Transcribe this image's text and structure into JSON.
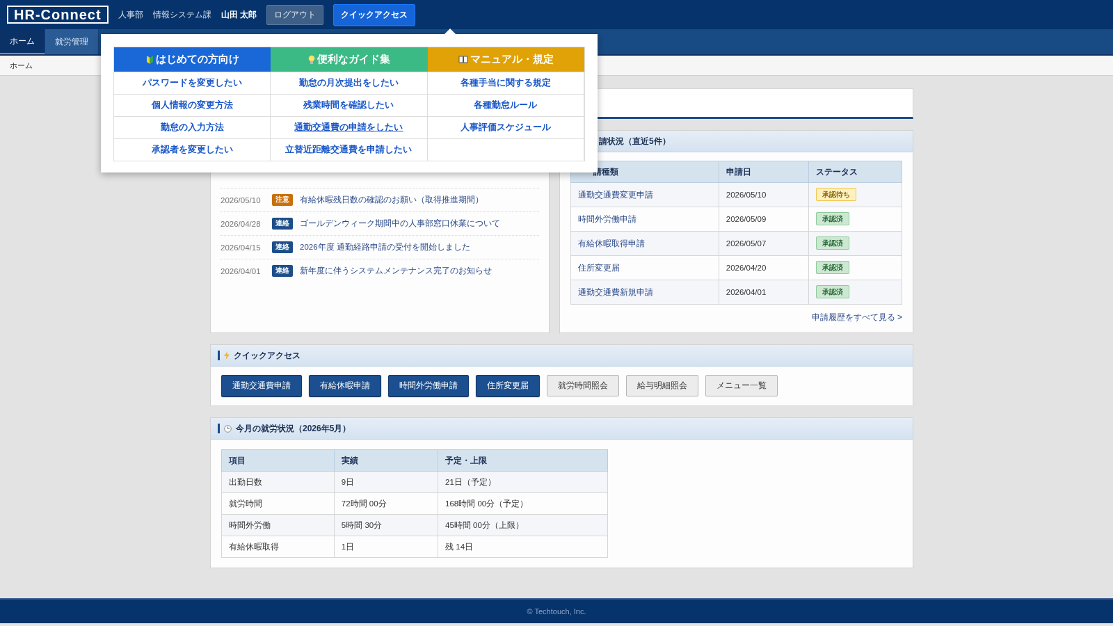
{
  "header": {
    "logo": "HR-Connect",
    "department": "人事部",
    "section": "情報システム課",
    "user": "山田 太郎",
    "buttons": [
      {
        "label": "ログアウト",
        "selected": false
      },
      {
        "label": "クイックアクセス",
        "selected": true
      }
    ]
  },
  "nav_tabs": [
    {
      "label": "ホーム",
      "selected": true
    },
    {
      "label": "就労管理",
      "selected": false
    }
  ],
  "breadcrumb": "ホーム",
  "quick_access_menu": {
    "columns": [
      {
        "title": "はじめての方向け",
        "kind": "beginner",
        "color": "#1a68d8",
        "items": [
          {
            "label": "パスワードを変更したい",
            "hovered": false
          },
          {
            "label": "個人情報の変更方法",
            "hovered": false
          },
          {
            "label": "勤怠の入力方法",
            "hovered": false
          },
          {
            "label": "承認者を変更したい",
            "hovered": false
          }
        ]
      },
      {
        "title": "便利なガイド集",
        "kind": "guide",
        "color": "#3cba86",
        "items": [
          {
            "label": "勤怠の月次提出をしたい",
            "hovered": false
          },
          {
            "label": "残業時間を確認したい",
            "hovered": false
          },
          {
            "label": "通勤交通費の申請をしたい",
            "hovered": true
          },
          {
            "label": "立替近距離交通費を申請したい",
            "hovered": false
          }
        ]
      },
      {
        "title": "マニュアル・規定",
        "kind": "manual",
        "color": "#e0a206",
        "items": [
          {
            "label": "各種手当に関する規定",
            "hovered": false
          },
          {
            "label": "各種勤怠ルール",
            "hovered": false
          },
          {
            "label": "人事評価スケジュール",
            "hovered": false
          }
        ]
      }
    ]
  },
  "notices": [
    {
      "date": "2026/05/10",
      "badge": "注意",
      "kind": "caution",
      "title": "有給休暇残日数の確認のお願い（取得推進期間）"
    },
    {
      "date": "2026/04/28",
      "badge": "連絡",
      "kind": "contact",
      "title": "ゴールデンウィーク期間中の人事部窓口休業について"
    },
    {
      "date": "2026/04/15",
      "badge": "連絡",
      "kind": "contact",
      "title": "2026年度 通勤経路申請の受付を開始しました"
    },
    {
      "date": "2026/04/01",
      "badge": "連絡",
      "kind": "contact",
      "title": "新年度に伴うシステムメンテナンス完了のお知らせ"
    }
  ],
  "applications": {
    "title": "請状況（直近5件）",
    "columns": [
      "請種類",
      "申請日",
      "ステータス"
    ],
    "rows": [
      {
        "type": "通勤交通費変更申請",
        "date": "2026/05/10",
        "status": "承認待ち",
        "kind": "pending"
      },
      {
        "type": "時間外労働申請",
        "date": "2026/05/09",
        "status": "承認済",
        "kind": "approved"
      },
      {
        "type": "有給休暇取得申請",
        "date": "2026/05/07",
        "status": "承認済",
        "kind": "approved"
      },
      {
        "type": "住所変更届",
        "date": "2026/04/20",
        "status": "承認済",
        "kind": "approved"
      },
      {
        "type": "通勤交通費新規申請",
        "date": "2026/04/01",
        "status": "承認済",
        "kind": "approved"
      }
    ],
    "more_link": "申請履歴をすべて見る >"
  },
  "quick_access": {
    "title": "クイックアクセス",
    "buttons": [
      {
        "label": "通勤交通費申請",
        "kind": "primary"
      },
      {
        "label": "有給休暇申請",
        "kind": "primary"
      },
      {
        "label": "時間外労働申請",
        "kind": "primary"
      },
      {
        "label": "住所変更届",
        "kind": "primary"
      },
      {
        "label": "就労時間照会",
        "kind": "secondary"
      },
      {
        "label": "給与明細照会",
        "kind": "secondary"
      },
      {
        "label": "メニュー一覧",
        "kind": "secondary"
      }
    ]
  },
  "work_status": {
    "title": "今月の就労状況（2026年5月）",
    "columns": [
      "項目",
      "実績",
      "予定・上限"
    ],
    "rows": [
      [
        "出勤日数",
        "9日",
        "21日（予定）"
      ],
      [
        "就労時間",
        "72時間 00分",
        "168時間 00分（予定）"
      ],
      [
        "時間外労働",
        "5時間 30分",
        "45時間 00分（上限）"
      ],
      [
        "有給休暇取得",
        "1日",
        "残 14日"
      ]
    ]
  },
  "footer": "© Techtouch, Inc."
}
